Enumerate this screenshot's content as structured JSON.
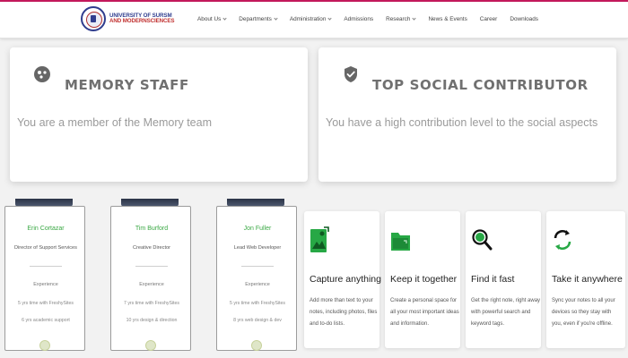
{
  "header": {
    "logo_line1": "UNIVERSITY OF SURSM",
    "logo_line2": "AND MODERNSCIENCES",
    "nav": [
      {
        "label": "About Us",
        "dropdown": true
      },
      {
        "label": "Departments",
        "dropdown": true
      },
      {
        "label": "Administration",
        "dropdown": true
      },
      {
        "label": "Admissions",
        "dropdown": false
      },
      {
        "label": "Research",
        "dropdown": true
      },
      {
        "label": "News & Events",
        "dropdown": false
      },
      {
        "label": "Career",
        "dropdown": false
      },
      {
        "label": "Downloads",
        "dropdown": false
      }
    ]
  },
  "badges": [
    {
      "title": "MEMORY STAFF",
      "description": "You are a member of the Memory team",
      "icon": "memory-icon"
    },
    {
      "title": "TOP SOCIAL CONTRIBUTOR",
      "description": "You have a high contribution level to the social aspects",
      "icon": "shield-check-icon"
    }
  ],
  "staff": [
    {
      "name": "Erin Cortazar",
      "role": "Director of Support Services",
      "experience_label": "Experience",
      "line1": "5 yrs time with FreshySites",
      "line2": "6 yrs academic support"
    },
    {
      "name": "Tim Burford",
      "role": "Creative Director",
      "experience_label": "Experience",
      "line1": "7 yrs time with FreshySites",
      "line2": "10 yrs design & direction"
    },
    {
      "name": "Jon Fuller",
      "role": "Lead Web Developer",
      "experience_label": "Experience",
      "line1": "5 yrs time with FreshySites",
      "line2": "8 yrs web design & dev"
    }
  ],
  "features": [
    {
      "title": "Capture anything",
      "description": "Add more than text to your notes, including photos, files and to-do lists.",
      "icon": "image-note-icon"
    },
    {
      "title": "Keep it together",
      "description": "Create a personal space for all your most important ideas and information.",
      "icon": "folder-icon"
    },
    {
      "title": "Find it fast",
      "description": "Get the right note, right away with powerful search and keyword tags.",
      "icon": "search-icon"
    },
    {
      "title": "Take it anywhere",
      "description": "Sync your notes to all your devices so they stay with you, even if you're offline.",
      "icon": "sync-icon"
    }
  ],
  "colors": {
    "accent": "#c2185b",
    "staff_name": "#3aa844",
    "feature_icon": "#27a845",
    "logo_blue": "#2f3d8e",
    "logo_red": "#c0302f"
  }
}
